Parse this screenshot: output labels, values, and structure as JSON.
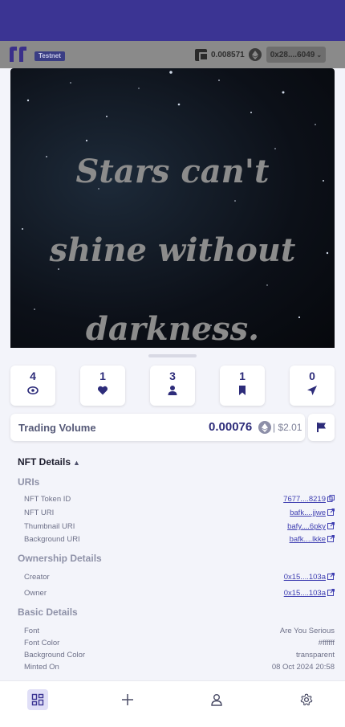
{
  "header": {
    "network_badge": "Testnet",
    "wallet_balance": "0.008571",
    "wallet_address": "0x28....6049"
  },
  "nft_image": {
    "quote_lines": [
      "Stars can't",
      "shine without",
      "darkness."
    ]
  },
  "stats": {
    "views": "4",
    "likes": "1",
    "owners": "3",
    "bookmarks": "1",
    "shares": "0"
  },
  "trading": {
    "label": "Trading Volume",
    "value": "0.00076",
    "usd": "| $2.01"
  },
  "details": {
    "title": "NFT Details",
    "uris": {
      "title": "URIs",
      "token_id_label": "NFT Token ID",
      "token_id_value": "7677....8219",
      "nft_uri_label": "NFT URI",
      "nft_uri_value": "bafk....jjwe",
      "thumbnail_label": "Thumbnail URI",
      "thumbnail_value": "bafy....6pky",
      "background_label": "Background URI",
      "background_value": "bafk....lkke"
    },
    "ownership": {
      "title": "Ownership Details",
      "creator_label": "Creator",
      "creator_value": "0x15....103a",
      "owner_label": "Owner",
      "owner_value": "0x15....103a"
    },
    "basic": {
      "title": "Basic Details",
      "font_label": "Font",
      "font_value": "Are You Serious",
      "font_color_label": "Font Color",
      "font_color_value": "#ffffff",
      "bg_color_label": "Background Color",
      "bg_color_value": "transparent",
      "minted_label": "Minted On",
      "minted_value": "08 Oct 2024 20:58"
    }
  },
  "colors": {
    "brand": "#3b3493",
    "accent": "#2d2c7a"
  }
}
